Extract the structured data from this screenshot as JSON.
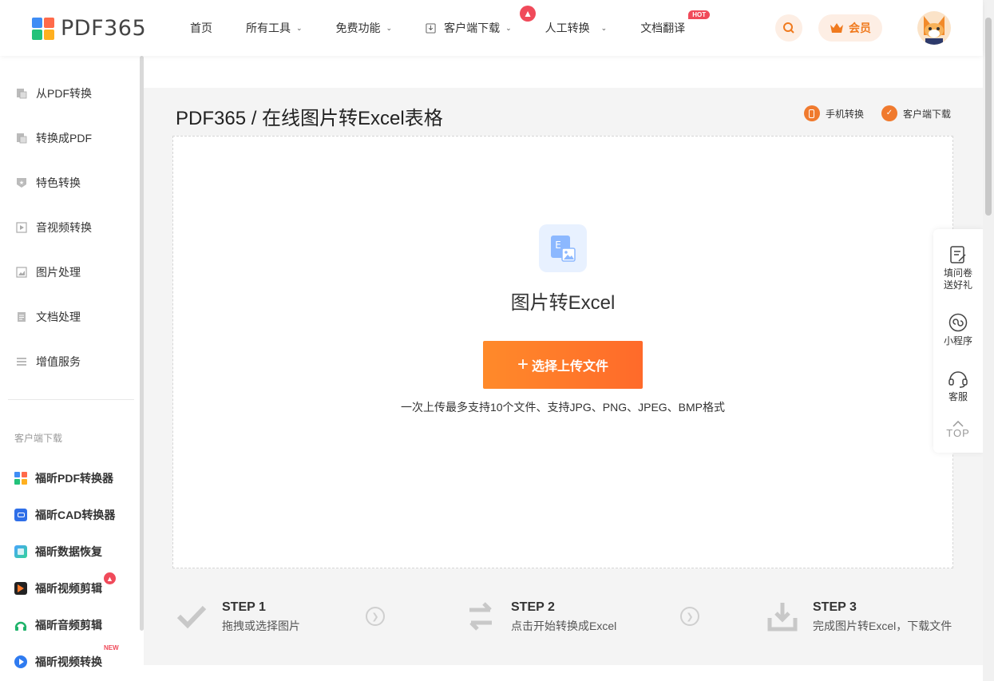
{
  "header": {
    "logo_text": "PDF365",
    "nav": [
      {
        "label": "首页"
      },
      {
        "label": "所有工具"
      },
      {
        "label": "免费功能"
      },
      {
        "label": "客户端下载"
      },
      {
        "label": "人工转换"
      },
      {
        "label": "文档翻译",
        "badge": "HOT"
      }
    ],
    "vip_label": "会员"
  },
  "sidebar": {
    "items": [
      {
        "label": "从PDF转换"
      },
      {
        "label": "转换成PDF"
      },
      {
        "label": "特色转换"
      },
      {
        "label": "音视频转换"
      },
      {
        "label": "图片处理"
      },
      {
        "label": "文档处理"
      },
      {
        "label": "增值服务"
      }
    ],
    "section_title": "客户端下载",
    "apps": [
      {
        "label": "福昕PDF转换器"
      },
      {
        "label": "福昕CAD转换器"
      },
      {
        "label": "福昕数据恢复"
      },
      {
        "label": "福昕视频剪辑"
      },
      {
        "label": "福昕音频剪辑"
      },
      {
        "label": "福昕视频转换",
        "badge": "NEW"
      }
    ]
  },
  "main": {
    "title": "PDF365 / 在线图片转Excel表格",
    "links": [
      {
        "label": "手机转换"
      },
      {
        "label": "客户端下载"
      }
    ],
    "tool_name": "图片转Excel",
    "upload_button": "选择上传文件",
    "upload_plus": "+",
    "upload_hint": "一次上传最多支持10个文件、支持JPG、PNG、JPEG、BMP格式",
    "steps": [
      {
        "title": "STEP 1",
        "desc": "拖拽或选择图片"
      },
      {
        "title": "STEP 2",
        "desc": "点击开始转换成Excel"
      },
      {
        "title": "STEP 3",
        "desc": "完成图片转Excel，下载文件"
      }
    ]
  },
  "float": {
    "items": [
      {
        "label_line1": "填问卷",
        "label_line2": "送好礼"
      },
      {
        "label_line1": "小程序"
      },
      {
        "label_line1": "客服"
      }
    ],
    "top_label": "TOP"
  },
  "colors": {
    "accent": "#ff7a2a",
    "fire": "#f04a5a",
    "main_bg": "#f4f4f4"
  }
}
